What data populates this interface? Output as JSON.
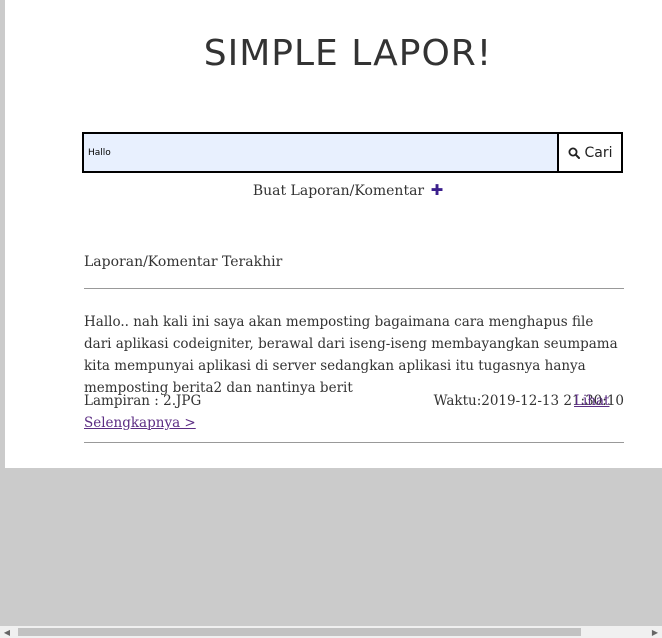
{
  "header": {
    "title": "SIMPLE LAPOR!"
  },
  "search": {
    "value": "Hallo",
    "button_label": "Cari",
    "icon": "search-icon"
  },
  "actions": {
    "create_label": "Buat Laporan/Komentar",
    "create_icon": "plus-icon",
    "create_icon_glyph": "✚",
    "accent_color": "#3b1f8c"
  },
  "reports": {
    "section_title": "Laporan/Komentar Terakhir",
    "items": [
      {
        "body": "Hallo.. nah kali ini saya akan memposting bagaimana cara menghapus file dari aplikasi codeigniter, berawal dari iseng-iseng membayangkan seumpama kita mempunyai aplikasi di server sedangkan aplikasi itu tugasnya hanya memposting berita2 dan nantinya berit",
        "attachment": "Lampiran : 2.JPG",
        "time": "Waktu:2019-12-13 21:30:10",
        "read_more": "Lihat Selengkapnya >"
      }
    ]
  },
  "scrollbar": {
    "left_arrow": "◀",
    "right_arrow": "▶"
  }
}
